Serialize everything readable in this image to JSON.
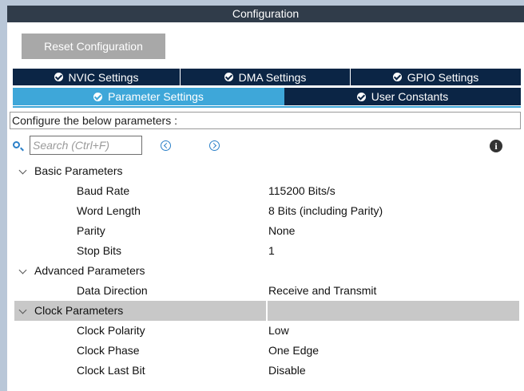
{
  "window": {
    "title": "Configuration"
  },
  "toolbar": {
    "reset_label": "Reset Configuration"
  },
  "tabs_row1": [
    {
      "label": "NVIC Settings"
    },
    {
      "label": "DMA Settings"
    },
    {
      "label": "GPIO Settings"
    }
  ],
  "tabs_row2": [
    {
      "label": "Parameter Settings",
      "active": true
    },
    {
      "label": "User Constants",
      "active": false
    }
  ],
  "config_header": "Configure the below parameters :",
  "search": {
    "placeholder": "Search (Ctrl+F)",
    "value": ""
  },
  "icons": {
    "search": "search-icon",
    "prev": "previous-icon",
    "next": "next-icon",
    "info": "info-icon",
    "tab_check": "check-circle-icon",
    "group_toggle": "chevron-down-icon"
  },
  "colors": {
    "title_bar": "#303c4a",
    "tab_inactive": "#0b2545",
    "tab_active": "#3ea7d9",
    "reset_button": "#a8a8a8",
    "selected_group_row": "#c8c8c8",
    "icon_blue": "#2b80c8"
  },
  "groups": [
    {
      "label": "Basic Parameters",
      "expanded": true,
      "params": [
        {
          "label": "Baud Rate",
          "value": "115200 Bits/s"
        },
        {
          "label": "Word Length",
          "value": "8 Bits (including Parity)"
        },
        {
          "label": "Parity",
          "value": "None"
        },
        {
          "label": "Stop Bits",
          "value": "1"
        }
      ]
    },
    {
      "label": "Advanced Parameters",
      "expanded": true,
      "params": [
        {
          "label": "Data Direction",
          "value": "Receive and Transmit"
        }
      ]
    },
    {
      "label": "Clock Parameters",
      "expanded": true,
      "selected": true,
      "params": [
        {
          "label": "Clock Polarity",
          "value": "Low"
        },
        {
          "label": "Clock Phase",
          "value": "One Edge"
        },
        {
          "label": "Clock Last Bit",
          "value": "Disable"
        }
      ]
    }
  ]
}
